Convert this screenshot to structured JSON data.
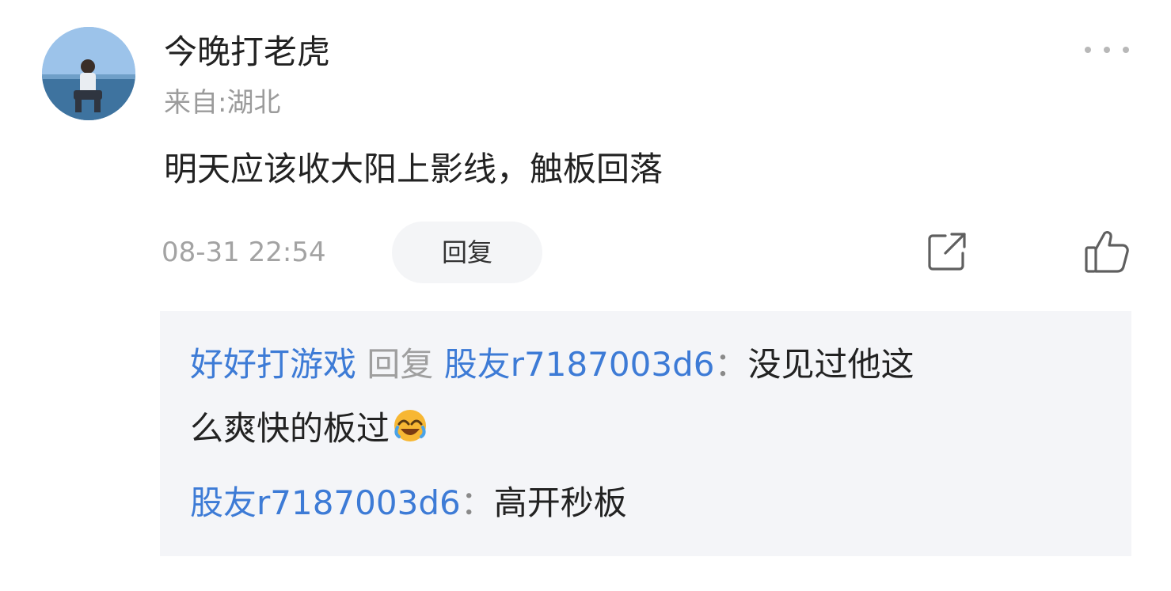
{
  "comment": {
    "username": "今晚打老虎",
    "location": "来自:湖北",
    "text": "明天应该收大阳上影线，触板回落",
    "timestamp": "08-31 22:54",
    "reply_label": "回复"
  },
  "icons": {
    "more": "more-icon",
    "share": "share-icon",
    "like": "thumbs-up-icon",
    "emoji": "laugh-cry-emoji"
  },
  "replies": [
    {
      "author": "好好打游戏",
      "reply_word": "回复",
      "target": "股友r7187003d6",
      "colon": "：",
      "text_line1": "没见过他这",
      "text_line2": "么爽快的板过"
    },
    {
      "author": "股友r7187003d6",
      "colon": "：",
      "text": "高开秒板"
    }
  ],
  "colors": {
    "link": "#3d7bd6",
    "muted": "#9b9b9b",
    "panel": "#f4f5f8"
  }
}
